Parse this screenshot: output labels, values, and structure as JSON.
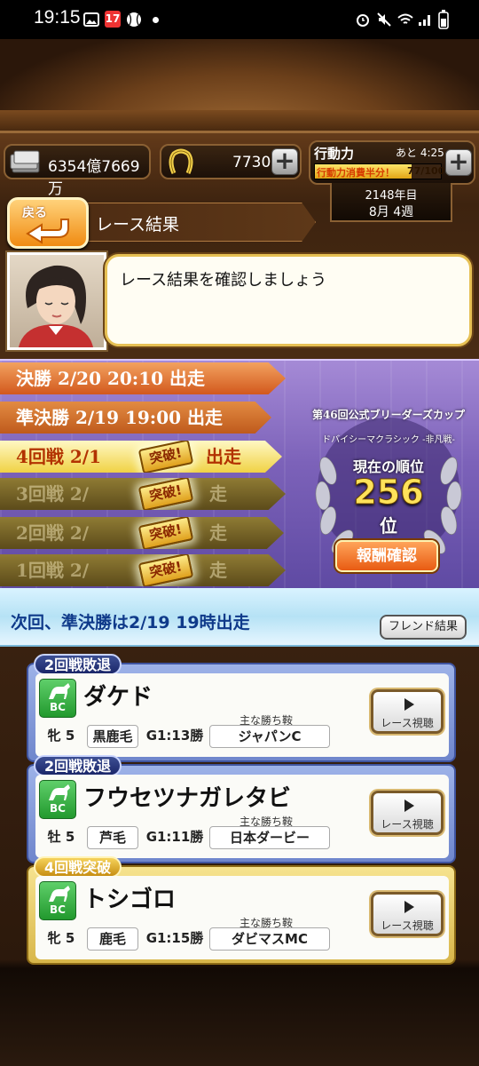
{
  "status_bar": {
    "time": "19:15"
  },
  "currency": {
    "money": "6354億7669万",
    "horseshoe": "7730"
  },
  "stamina": {
    "label": "行動力",
    "remaining": "あと 4:25",
    "bar_text": "行動力消費半分！",
    "value": "77/100",
    "fill_fraction": 0.77
  },
  "calendar": {
    "year": "2148年目",
    "week": "8月 4週"
  },
  "header": {
    "back_label": "戻る",
    "title": "レース結果"
  },
  "message": {
    "text": "レース結果を確認しましょう"
  },
  "rounds": [
    {
      "label": "決勝 2/20 20:10 出走",
      "state": "upcoming"
    },
    {
      "label": "準決勝 2/19 19:00 出走",
      "state": "upcoming"
    },
    {
      "label": "4回戦 2/1",
      "suffix": "出走",
      "stamp": "突破!",
      "state": "current"
    },
    {
      "label": "3回戦 2/",
      "suffix": "走",
      "stamp": "突破!",
      "state": "done"
    },
    {
      "label": "2回戦 2/",
      "suffix": "走",
      "stamp": "突破!",
      "state": "done"
    },
    {
      "label": "1回戦 2/",
      "suffix": "走",
      "stamp": "突破!",
      "state": "done"
    }
  ],
  "cup": {
    "name": "第46回公式ブリーダーズカップ",
    "race": "ドバイシーマクラシック",
    "tag": "-非凡戦-",
    "rank_label": "現在の順位",
    "rank": "256",
    "rank_unit": "位",
    "reward_button": "報酬確認"
  },
  "next_banner": {
    "text": "次回、準決勝は2/19 19時出走",
    "friend_button": "フレンド結果"
  },
  "horses": [
    {
      "status": "2回戦敗退",
      "name": "ダケド",
      "sex_age": "牝 5",
      "coat": "黒鹿毛",
      "g1": "G1:13勝",
      "wins_label": "主な勝ち鞍",
      "win": "ジャパンC",
      "badge": "BC",
      "watch": "レース視聴",
      "gold": false
    },
    {
      "status": "2回戦敗退",
      "name": "フウセツナガレタビ",
      "sex_age": "牡 5",
      "coat": "芦毛",
      "g1": "G1:11勝",
      "wins_label": "主な勝ち鞍",
      "win": "日本ダービー",
      "badge": "BC",
      "watch": "レース視聴",
      "gold": false
    },
    {
      "status": "4回戦突破",
      "name": "トシゴロ",
      "sex_age": "牝 5",
      "coat": "鹿毛",
      "g1": "G1:15勝",
      "wins_label": "主な勝ち鞍",
      "win": "ダビマスMC",
      "badge": "BC",
      "watch": "レース視聴",
      "gold": true
    }
  ]
}
